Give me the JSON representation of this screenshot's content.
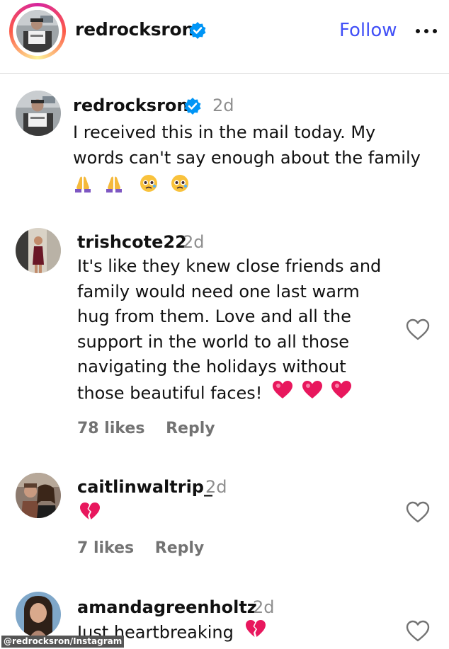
{
  "header": {
    "username": "redrocksron",
    "follow_label": "Follow",
    "more_icon": "more-horizontal-icon"
  },
  "caption": {
    "username": "redrocksron",
    "time": "2d",
    "text_line1": "I received this in the mail today. My",
    "text_line2": "words can't say enough about the family"
  },
  "comments": [
    {
      "username": "trishcote22",
      "time": "2d",
      "lines": [
        "It's like they knew close friends and",
        "family would need one last warm",
        "hug from them. Love and all the",
        "support in the world to all those",
        "navigating the holidays without",
        "those beautiful faces!"
      ],
      "likes": "78 likes",
      "reply": "Reply"
    },
    {
      "username": "caitlinwaltrip_",
      "time": "2d",
      "likes": "7 likes",
      "reply": "Reply"
    },
    {
      "username": "amandagreenholtz",
      "time": "2d",
      "text": "Just heartbreaking"
    }
  ],
  "credit": "@redrocksron/Instagram",
  "colors": {
    "follow_blue": "#4150f7",
    "verified_blue": "#0095f6",
    "muted_gray": "#737373",
    "heart_pink": "#e8175d"
  }
}
